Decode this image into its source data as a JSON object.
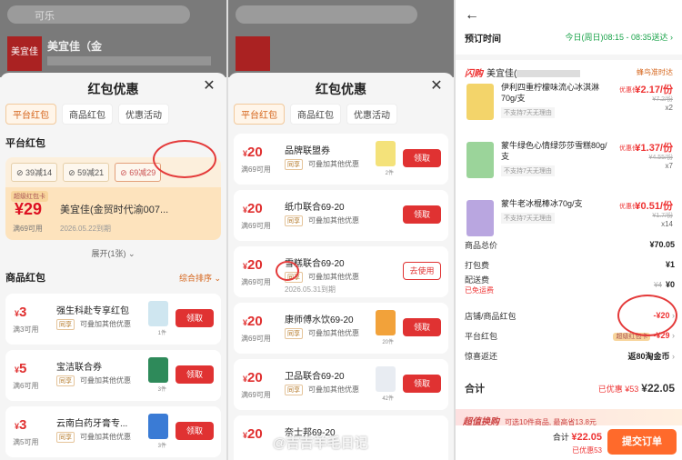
{
  "panel1": {
    "search_placeholder": "可乐",
    "store_logo": "美宜佳",
    "store_name": "美宜佳（金",
    "sheet_title": "红包优惠",
    "tabs": [
      "平台红包",
      "商品红包",
      "优惠活动"
    ],
    "platform_section": "平台红包",
    "chips": [
      "39减14",
      "59减21",
      "69减29"
    ],
    "big_coupon": {
      "tag": "超级红包卡",
      "amount": "¥29",
      "condition": "满69可用",
      "name": "美宜佳(金贸时代渝007...",
      "expiry": "2026.05.22到期"
    },
    "expand": "展开(1张)",
    "goods_section": "商品红包",
    "sort": "综合排序",
    "coupons": [
      {
        "amount": "3",
        "cond": "满3可用",
        "name": "强生科赴专享红包",
        "tag": "同享",
        "note": "可叠加其他优惠",
        "count": "1件",
        "btn": "领取"
      },
      {
        "amount": "5",
        "cond": "满6可用",
        "name": "宝洁联合券",
        "tag": "同享",
        "note": "可叠加其他优惠",
        "count": "3件",
        "btn": "领取"
      },
      {
        "amount": "3",
        "cond": "满5可用",
        "name": "云南白药牙膏专...",
        "tag": "同享",
        "note": "可叠加其他优惠",
        "count": "3件",
        "btn": "领取"
      }
    ]
  },
  "panel2": {
    "sheet_title": "红包优惠",
    "tabs": [
      "平台红包",
      "商品红包",
      "优惠活动"
    ],
    "coupons": [
      {
        "amount": "20",
        "cond": "满69可用",
        "name": "品牌联盟券",
        "tag": "同享",
        "note": "可叠加其他优惠",
        "expiry": "",
        "count": "2件",
        "btn": "领取",
        "ghost": false
      },
      {
        "amount": "20",
        "cond": "满69可用",
        "name": "纸巾联合69-20",
        "tag": "同享",
        "note": "可叠加其他优惠",
        "expiry": "",
        "count": "",
        "btn": "领取",
        "ghost": false
      },
      {
        "amount": "20",
        "cond": "满69可用",
        "name": "雪糕联合69-20",
        "tag": "同享",
        "note": "可叠加其他优惠",
        "expiry": "2026.05.31到期",
        "count": "",
        "btn": "去使用",
        "ghost": true
      },
      {
        "amount": "20",
        "cond": "满69可用",
        "name": "康师傅水饮69-20",
        "tag": "同享",
        "note": "可叠加其他优惠",
        "expiry": "",
        "count": "20件",
        "btn": "领取",
        "ghost": false
      },
      {
        "amount": "20",
        "cond": "满69可用",
        "name": "卫品联合69-20",
        "tag": "同享",
        "note": "可叠加其他优惠",
        "expiry": "",
        "count": "42件",
        "btn": "领取",
        "ghost": false
      },
      {
        "amount": "20",
        "cond": "",
        "name": "奈士邦69-20",
        "tag": "",
        "note": "",
        "expiry": "",
        "count": "",
        "btn": "",
        "ghost": false
      }
    ]
  },
  "panel3": {
    "title": "预订时间",
    "time": "今日(周日)08:15 - 08:35送达",
    "flash": "闪购",
    "shop": "美宜佳(",
    "delivery": "蜂鸟准时达",
    "items": [
      {
        "name": "伊利四重柠檬味流心冰淇淋70g/支",
        "sub": "不支持7天无理由",
        "label": "优惠价",
        "price": "¥2.17/份",
        "orig": "¥7.2/份",
        "qty": "x2",
        "color": "#f3d46a"
      },
      {
        "name": "蒙牛绿色心情绿莎莎雪糕80g/支",
        "sub": "不支持7天无理由",
        "label": "优惠价",
        "price": "¥1.37/份",
        "orig": "¥4.55/份",
        "qty": "x7",
        "color": "#9bd49a"
      },
      {
        "name": "蒙牛老冰棍棒冰70g/支",
        "sub": "不支持7天无理由",
        "label": "优惠价",
        "price": "¥0.51/份",
        "orig": "¥1.7/份",
        "qty": "x14",
        "color": "#b9a6e0"
      }
    ],
    "rows": [
      {
        "k": "商品总价",
        "v": "¥70.05"
      },
      {
        "k": "打包费",
        "v": "¥1"
      },
      {
        "k": "配送费",
        "v": "¥0",
        "strike": "¥4",
        "extra": "已免运费"
      },
      {
        "k": "店铺/商品红包",
        "v": "-¥20"
      },
      {
        "k": "平台红包",
        "v": "-¥29",
        "tag": "超级红包卡"
      },
      {
        "k": "惊喜返还",
        "v": "返80淘金币"
      }
    ],
    "total_label": "合计",
    "total_saved": "已优惠 ¥53",
    "total": "¥22.05",
    "ad_title": "超值换购",
    "ad_text": "可选10件商品, 最高省13.8元",
    "bottom_total_label": "合计",
    "bottom_total": "¥22.05",
    "bottom_saved": "已优惠53",
    "submit": "提交订单"
  },
  "watermark": "@吉吉羊毛日记",
  "colors": {
    "accent": "#e03232",
    "orange": "#ff6a2b",
    "green": "#1aa34a"
  }
}
